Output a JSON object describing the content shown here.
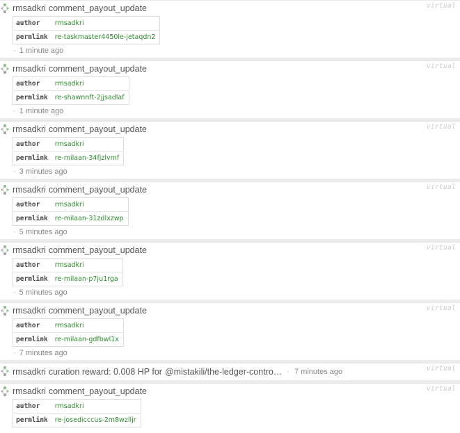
{
  "virtual_label": "virtual",
  "key_author": "author",
  "key_permlink": "permlink",
  "ops": [
    {
      "account": "rmsadkri",
      "type": "comment_payout_update",
      "author": "rmsadkri",
      "permlink": "re-taskmaster4450le-jetaqdn2",
      "ago": "1 minute ago"
    },
    {
      "account": "rmsadkri",
      "type": "comment_payout_update",
      "author": "rmsadkri",
      "permlink": "re-shawnnft-2jjsadlaf",
      "ago": "1 minute ago"
    },
    {
      "account": "rmsadkri",
      "type": "comment_payout_update",
      "author": "rmsadkri",
      "permlink": "re-milaan-34fjzlvmf",
      "ago": "3 minutes ago"
    },
    {
      "account": "rmsadkri",
      "type": "comment_payout_update",
      "author": "rmsadkri",
      "permlink": "re-milaan-31zdlxzwp",
      "ago": "5 minutes ago"
    },
    {
      "account": "rmsadkri",
      "type": "comment_payout_update",
      "author": "rmsadkri",
      "permlink": "re-milaan-p7ju1rga",
      "ago": "5 minutes ago"
    },
    {
      "account": "rmsadkri",
      "type": "comment_payout_update",
      "author": "rmsadkri",
      "permlink": "re-milaan-gdfbwl1x",
      "ago": "7 minutes ago"
    }
  ],
  "reward": {
    "account": "rmsadkri",
    "text": "curation reward: 0.008 HP for",
    "link": "@mistakili/the-ledger-contro…",
    "ago": "7 minutes ago"
  },
  "last_op": {
    "account": "rmsadkri",
    "type": "comment_payout_update",
    "author": "rmsadkri",
    "permlink": "re-josedicccus-2m8wzlljr"
  }
}
